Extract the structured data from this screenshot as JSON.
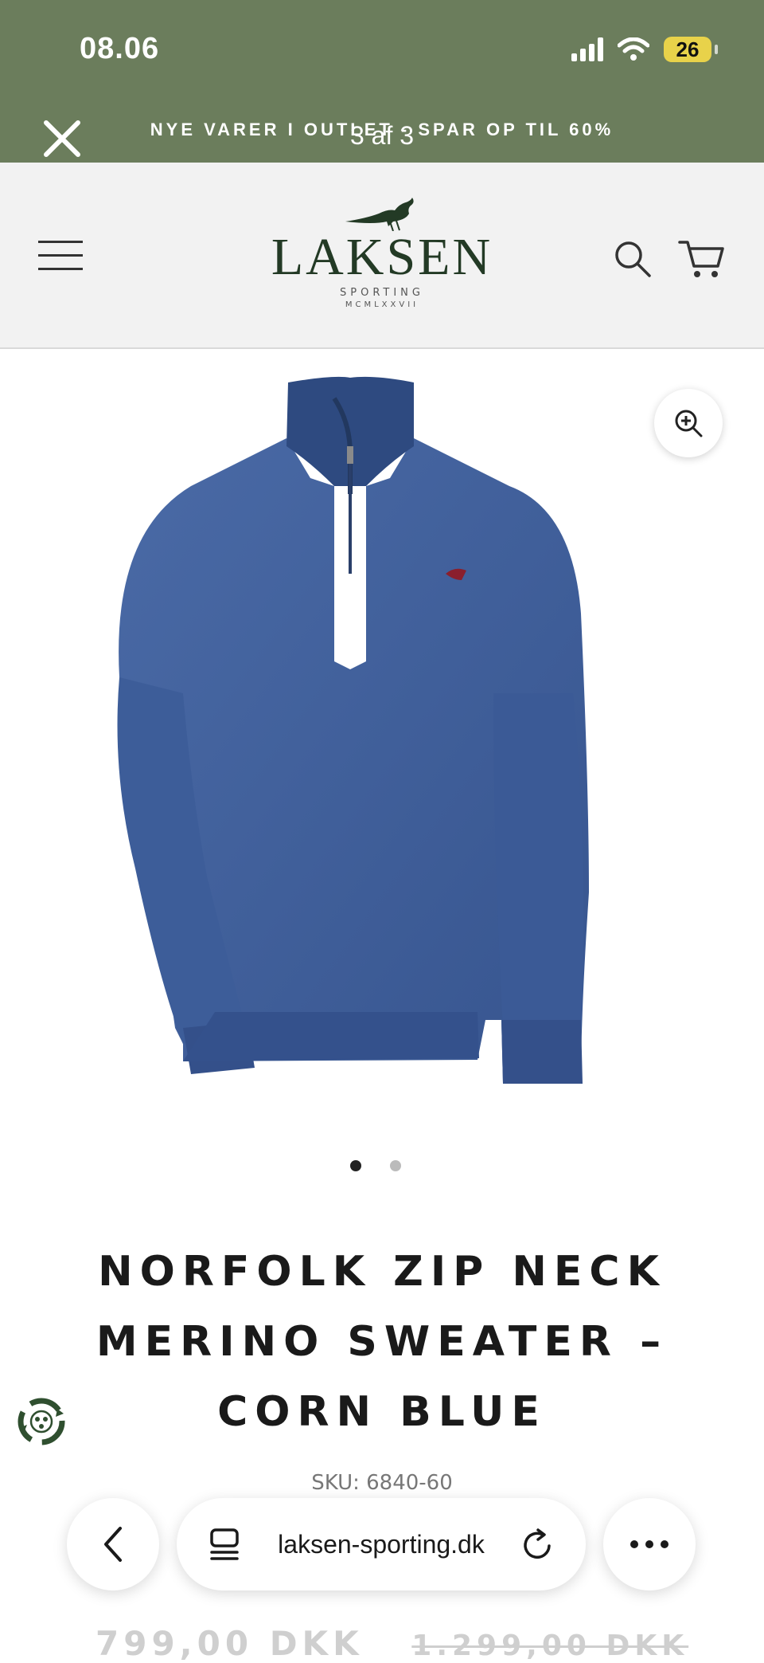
{
  "status_bar": {
    "time": "08.06",
    "battery": "26"
  },
  "announcement": {
    "text": "NYE VARER I OUTLET - SPAR OP TIL 60%",
    "pager": "3 af 3"
  },
  "logo": {
    "name": "LAKSEN",
    "sub": "SPORTING",
    "year": "MCMLXXVII"
  },
  "product": {
    "title": "NORFOLK ZIP NECK MERINO SWEATER – CORN BLUE",
    "sku": "SKU: 6840-60",
    "price": "799,00 DKK",
    "old_price": "1.299,00 DKK",
    "image_count": 2,
    "active_image": 1
  },
  "browser": {
    "url": "laksen-sporting.dk"
  },
  "icons": {
    "close": "close-icon",
    "menu": "hamburger-icon",
    "search": "search-icon",
    "cart": "cart-icon",
    "zoom": "zoom-in-icon",
    "back": "chevron-left-icon",
    "tabs": "tab-icon",
    "reload": "reload-icon",
    "more": "more-icon",
    "badge": "recycle-icon"
  },
  "colors": {
    "brand_green": "#6b7d5c",
    "logo_green": "#233a25",
    "sweater_blue": "#3f5f98"
  }
}
